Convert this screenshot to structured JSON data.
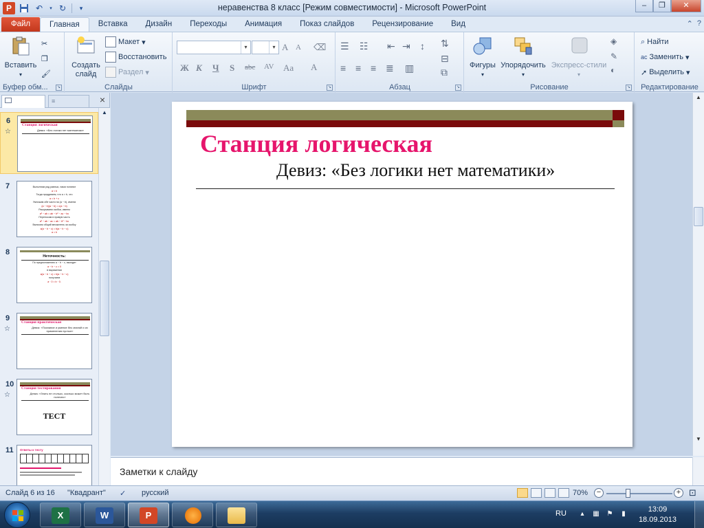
{
  "window": {
    "title": "неравенства 8 класс [Режим совместимости] - Microsoft PowerPoint",
    "qat_app": "P",
    "controls": {
      "minimize": "–",
      "maximize": "❐",
      "close": "✕"
    }
  },
  "ribbon": {
    "tabs": [
      "Файл",
      "Главная",
      "Вставка",
      "Дизайн",
      "Переходы",
      "Анимация",
      "Показ слайдов",
      "Рецензирование",
      "Вид"
    ],
    "active_tab": "Главная",
    "right_controls": [
      "⌃",
      "?"
    ],
    "groups": {
      "clipboard": {
        "label": "Буфер обм...",
        "paste": "Вставить"
      },
      "slides": {
        "label": "Слайды",
        "new_slide": "Создать слайд",
        "layout": "Макет",
        "reset": "Восстановить",
        "section": "Раздел"
      },
      "font": {
        "label": "Шрифт",
        "bold": "Ж",
        "italic": "К",
        "underline": "Ч",
        "shadow": "S",
        "strike": "abc",
        "spacing": "AV",
        "case": "Aa",
        "color": "A",
        "grow": "A",
        "shrink": "A"
      },
      "paragraph": {
        "label": "Абзац"
      },
      "drawing": {
        "label": "Рисование",
        "shapes": "Фигуры",
        "arrange": "Упорядочить",
        "quick_styles": "Экспресс-стили"
      },
      "editing": {
        "label": "Редактирование",
        "find": "Найти",
        "replace": "Заменить",
        "select": "Выделить"
      }
    }
  },
  "slides_panel": {
    "thumbs": [
      {
        "num": "6",
        "title": "Станция логическая",
        "motto": "Девиз: «Без логики нет математики»",
        "selected": true,
        "anim": true
      },
      {
        "num": "7",
        "lines": [
          "Выполним ряд равных, нами понятие",
          "a < b",
          "Тогда придумаем, что a > b, что",
          "a = b + c",
          "Умножим обе части на (a − b), имеем",
          "(a − b)(a − b) = c(a − b)",
          "Раскрываем скобки, имеем",
          "a² − ab = ab − b² − ac − bc",
          "Переносим в правую часть",
          "a² − ab − ac = ab − b² − bc",
          "Выносим общий множитель за скобку",
          "a(a − b − c) = b(a − b − c)",
          "a = b"
        ]
      },
      {
        "num": "8",
        "title": "Неточность:",
        "lines": [
          "По предположению a − b − c, выходит",
          "a − b − c = 0",
          "в выражении",
          "a(a − b − c) = b(a − b − c)",
          "получаем",
          "a · 0 = b · 0."
        ]
      },
      {
        "num": "9",
        "title": "Станция практическая",
        "motto": "Девиз: «Познание и умение без знаний и их применения пустые»",
        "anim": true
      },
      {
        "num": "10",
        "title": "Станция тестирования",
        "motto": "Девиз: «Знать не столько, сколько может быть полезно»",
        "body": "ТЕСТ",
        "anim": true
      },
      {
        "num": "11",
        "title": "Ответы к тесту"
      }
    ]
  },
  "slide": {
    "title": "Станция логическая",
    "motto": "Девиз: «Без логики нет математики»"
  },
  "notes": {
    "placeholder": "Заметки к слайду"
  },
  "status": {
    "slide": "Слайд 6 из 16",
    "theme": "\"Квадрант\"",
    "language": "русский",
    "zoom": "70%"
  },
  "taskbar": {
    "lang": "RU",
    "time": "13:09",
    "date": "18.09.2013"
  }
}
